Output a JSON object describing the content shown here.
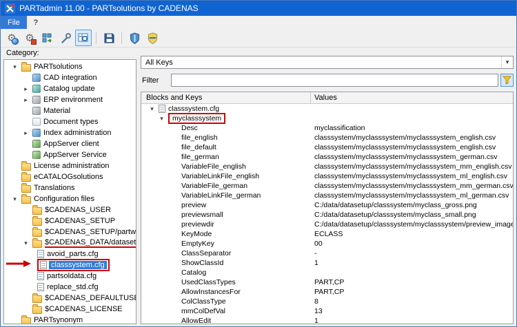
{
  "titlebar": {
    "title": "PARTadmin 11.00 - PARTsolutions by CADENAS"
  },
  "menubar": {
    "items": [
      {
        "label": "File"
      },
      {
        "label": "?"
      }
    ]
  },
  "icons": {
    "chevron_down": "▾",
    "chevron_right": "▸",
    "dropdown_arrow": "▾",
    "gear": "⚙"
  },
  "toolbar": {
    "buttons": [
      {
        "name": "configuration"
      },
      {
        "name": "settings"
      },
      {
        "name": "index-update"
      },
      {
        "name": "tools"
      },
      {
        "name": "table-view"
      },
      {
        "name": "save"
      },
      {
        "name": "shield-user"
      },
      {
        "name": "shield-admin"
      }
    ]
  },
  "category": {
    "label": "Category:",
    "tree": [
      {
        "label": "PARTsolutions"
      },
      {
        "label": "CAD integration"
      },
      {
        "label": "Catalog update"
      },
      {
        "label": "ERP environment"
      },
      {
        "label": "Material"
      },
      {
        "label": "Document types"
      },
      {
        "label": "Index administration"
      },
      {
        "label": "AppServer client"
      },
      {
        "label": "AppServer Service"
      },
      {
        "label": "License administration"
      },
      {
        "label": "eCATALOGsolutions"
      },
      {
        "label": "Translations"
      },
      {
        "label": "Configuration files"
      },
      {
        "label": "$CADENAS_USER"
      },
      {
        "label": "$CADENAS_SETUP"
      },
      {
        "label": "$CADENAS_SETUP/partwarehouse"
      },
      {
        "label": "$CADENAS_DATA/datasetup"
      },
      {
        "label": "avoid_parts.cfg"
      },
      {
        "label": "classsystem.cfg"
      },
      {
        "label": "partsoldata.cfg"
      },
      {
        "label": "replace_std.cfg"
      },
      {
        "label": "$CADENAS_DEFAULTUSER"
      },
      {
        "label": "$CADENAS_LICENSE"
      },
      {
        "label": "PARTsynonym"
      }
    ]
  },
  "keys_panel": {
    "combo_value": "All Keys",
    "filter_label": "Filter",
    "filter_value": "",
    "table": {
      "headers": [
        "Blocks and Keys",
        "Values"
      ],
      "rows": [
        {
          "key": "classsystem.cfg",
          "value": ""
        },
        {
          "key": "myclasssystem",
          "value": ""
        },
        {
          "key": "Desc",
          "value": "myclassification"
        },
        {
          "key": "file_english",
          "value": "classsystem/myclasssystem/myclasssystem_english.csv"
        },
        {
          "key": "file_default",
          "value": "classsystem/myclasssystem/myclasssystem_english.csv"
        },
        {
          "key": "file_german",
          "value": "classsystem/myclasssystem/myclasssystem_german.csv"
        },
        {
          "key": "VariableFile_english",
          "value": "classsystem/myclasssystem/myclasssystem_mm_english.csv"
        },
        {
          "key": "VariableLinkFile_english",
          "value": "classsystem/myclasssystem/myclasssystem_ml_english.csv"
        },
        {
          "key": "VariableFile_german",
          "value": "classsystem/myclasssystem/myclasssystem_mm_german.csv"
        },
        {
          "key": "VariableLinkFile_german",
          "value": "classsystem/myclasssystem/myclasssystem_ml_german.csv"
        },
        {
          "key": "preview",
          "value": "C:/data/datasetup/classsystem/myclass_gross.png"
        },
        {
          "key": "previewsmall",
          "value": "C:/data/datasetup/classsystem/myclass_small.png"
        },
        {
          "key": "previewdir",
          "value": "C:/data/datasetup/classsystem/myclasssystem/preview_images"
        },
        {
          "key": "KeyMode",
          "value": "ECLASS"
        },
        {
          "key": "EmptyKey",
          "value": "00"
        },
        {
          "key": "ClassSeparator",
          "value": "-"
        },
        {
          "key": "ShowClassId",
          "value": "1"
        },
        {
          "key": "Catalog",
          "value": ""
        },
        {
          "key": "UsedClassTypes",
          "value": "PART,CP"
        },
        {
          "key": "AllowInstancesFor",
          "value": "PART,CP"
        },
        {
          "key": "ColClassType",
          "value": "8"
        },
        {
          "key": "mmColDefVal",
          "value": "13"
        },
        {
          "key": "AllowEdit",
          "value": "1"
        }
      ]
    }
  }
}
